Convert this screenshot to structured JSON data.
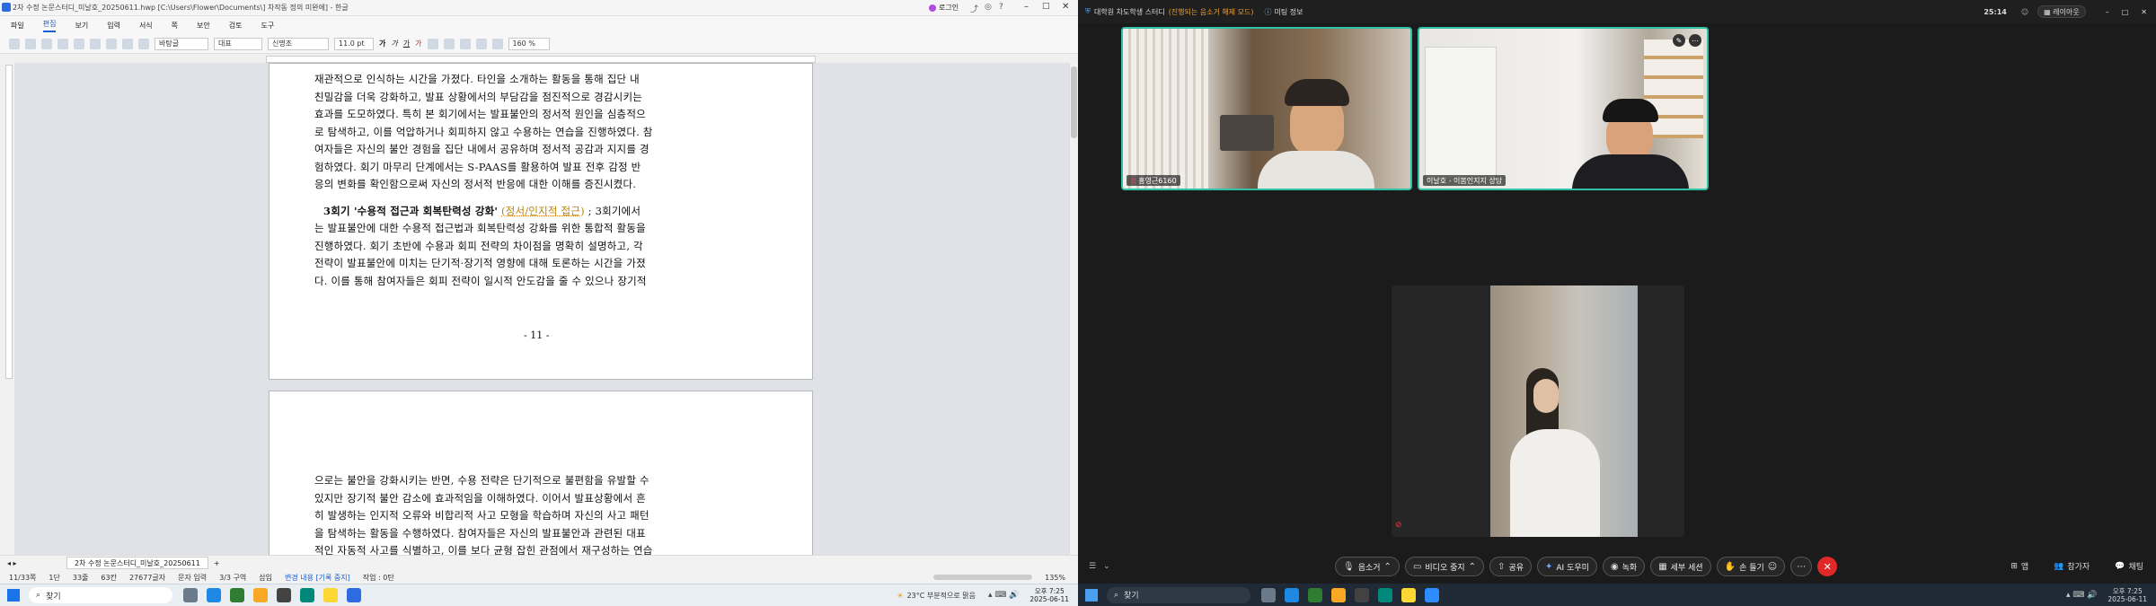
{
  "left_window": {
    "title": "2차 수정 논문스터디_미날호_20250611.hwp [C:\\Users\\Flower\\Documents\\] 차작동 정의 미완에] - 한글",
    "login_label": "로그인",
    "menu": [
      "파일",
      "편집",
      "보기",
      "입력",
      "서식",
      "쪽",
      "보안",
      "검토",
      "도구"
    ],
    "active_menu": "편집",
    "toolbar": {
      "style": "바탕글",
      "lang": "대표",
      "font": "신명조",
      "size": "11.0",
      "size_unit": "pt",
      "zoom": "160",
      "zoom_unit": "%"
    },
    "page1_lines": [
      "재관적으로 인식하는 시간을 가졌다. 타인을 소개하는 활동을 통해 집단 내",
      "친밀감을 더욱 강화하고, 발표 상황에서의 부담감을 점진적으로 경감시키는",
      "효과를 도모하였다. 특히 본 회기에서는 발표불안의 정서적 원인을 심층적으",
      "로 탐색하고, 이를 억압하거나 회피하지 않고 수용하는 연습을 진행하였다. 참",
      "여자들은 자신의 불안 경험을 집단 내에서 공유하며 정서적 공감과 지지를 경",
      "험하였다. 회기 마무리 단계에서는 S-PAAS를 활용하여 발표 전후 감정 반",
      "응의 변화를 확인함으로써 자신의 정서적 반응에 대한 이해를 증진시켰다."
    ],
    "page1_para2": {
      "heading": "3회기 '수용적 접근과 회복탄력성 강화'",
      "heading_tag": "(정서/인지적 접근)",
      "heading_rest": "; 3회기에서",
      "lines": [
        "는 발표불안에 대한 수용적 접근법과 회복탄력성 강화를 위한 통합적 활동을",
        "진행하였다. 회기 초반에 수용과 회피 전략의 차이점을 명확히 설명하고, 각",
        "전략이 발표불안에 미치는 단기적·장기적 영향에 대해 토론하는 시간을 가졌",
        "다. 이를 통해 참여자들은 회피 전략이 일시적 안도감을 줄 수 있으나 장기적"
      ]
    },
    "page_number": "- 11 -",
    "page2_lines": [
      "으로는 불안을 강화시키는 반면, 수용 전략은 단기적으로 불편함을 유발할 수",
      "있지만 장기적 불안 감소에 효과적임을 이해하였다. 이어서 발표상황에서 흔",
      "히 발생하는 인지적 오류와 비합리적 사고 모형을 학습하며 자신의 사고 패턴",
      "을 탐색하는 활동을 수행하였다. 참여자들은 자신의 발표불안과 관련된 대표",
      "적인 자동적 사고를 식별하고, 이를 보다 균형 잡힌 관점에서 재구성하는 연습"
    ],
    "doc_tab": "2차 수정 논문스터디_미날호_20250611",
    "status": {
      "page": "11/33쪽",
      "section": "1단",
      "line": "33줄",
      "col": "63칸",
      "chars": "27677글자",
      "mode": "문자 입력",
      "zone": "3/3 구역",
      "insert": "삽입",
      "track": "변경 내용 [기록 중지]",
      "task": "작업 : 0탄",
      "zoom": "135%"
    },
    "taskbar": {
      "search": "찾기",
      "weather": "23°C  부분적으로 맑음",
      "time": "오후 7:25",
      "date": "2025-06-11"
    }
  },
  "zoom": {
    "meeting_title": "대학원 차도학생 스터디",
    "meeting_sub": "(진행되는 음소거 해제 모드)",
    "info": "미팅 정보",
    "timer": "25:14",
    "layout": "레이아웃",
    "participants": [
      {
        "name": "홍영근6160",
        "active": true
      },
      {
        "name": "이날호 - 이봄인지지 상담",
        "active": true
      },
      {
        "name": "",
        "active": false
      }
    ],
    "controls": [
      {
        "icon": "mic-icon",
        "label": "음소거"
      },
      {
        "icon": "video-icon",
        "label": "비디오 중지"
      },
      {
        "icon": "share-icon",
        "label": "공유"
      },
      {
        "icon": "ai-icon",
        "label": "AI 도우미"
      },
      {
        "icon": "record-icon",
        "label": "녹화"
      },
      {
        "icon": "breakout-icon",
        "label": "세부 세션"
      },
      {
        "icon": "raise-hand-icon",
        "label": "손 들기"
      }
    ],
    "right_controls": [
      {
        "icon": "apps-icon",
        "label": "앱"
      },
      {
        "icon": "participants-icon",
        "label": "참가자"
      },
      {
        "icon": "chat-icon",
        "label": "채팅"
      }
    ],
    "taskbar": {
      "search": "찾기",
      "time": "오후 7:25",
      "date": "2025-06-11"
    },
    "colors": {
      "active_border": "#2fc2a4",
      "end": "#e02828"
    }
  }
}
